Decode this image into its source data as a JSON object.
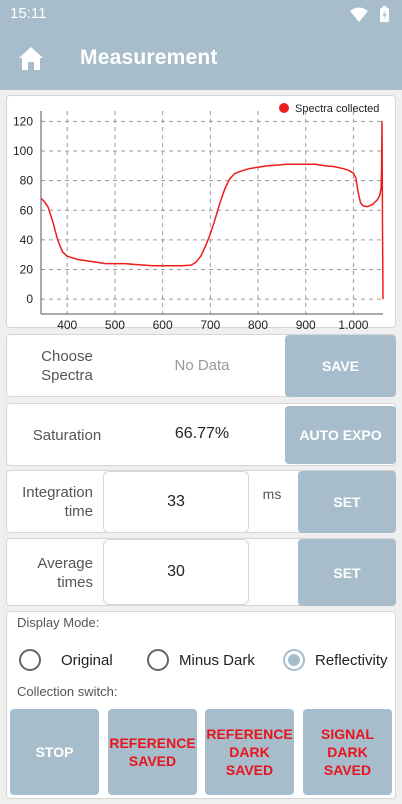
{
  "status_bar": {
    "time": "15:11",
    "icons": [
      "wifi-icon",
      "battery-charging-icon"
    ]
  },
  "app_bar": {
    "title": "Measurement",
    "home_icon": "home-icon"
  },
  "chart_data": {
    "type": "line",
    "title": "",
    "xlabel": "",
    "ylabel": "",
    "legend": {
      "label": "Spectra collected",
      "position": "top-right",
      "color": "#ee1c1c"
    },
    "xlim": [
      345,
      1062
    ],
    "ylim": [
      -10,
      127
    ],
    "x_ticks": [
      "400",
      "500",
      "600",
      "700",
      "800",
      "900",
      "1,000"
    ],
    "y_ticks": [
      "0",
      "20",
      "40",
      "60",
      "80",
      "100",
      "120"
    ],
    "grid": true,
    "series": [
      {
        "name": "Spectra collected",
        "color": "#ee1c1c",
        "x": [
          345,
          352,
          360,
          370,
          380,
          390,
          400,
          420,
          440,
          460,
          480,
          500,
          520,
          540,
          560,
          580,
          600,
          620,
          640,
          660,
          670,
          680,
          690,
          700,
          710,
          720,
          730,
          740,
          750,
          760,
          770,
          780,
          790,
          800,
          820,
          840,
          860,
          880,
          900,
          920,
          940,
          960,
          980,
          990,
          1000,
          1005,
          1010,
          1015,
          1020,
          1030,
          1040,
          1050,
          1055,
          1058,
          1059,
          1060,
          1061,
          1062
        ],
        "y": [
          68,
          66,
          62,
          52,
          40,
          32,
          29,
          27,
          26,
          25,
          24,
          24,
          24,
          23.5,
          23,
          22.5,
          22.5,
          22.5,
          22.5,
          23,
          25,
          29,
          36,
          44,
          54,
          65,
          74,
          81,
          84.5,
          86,
          87,
          88,
          88.5,
          89,
          90,
          90.5,
          91,
          91,
          91,
          91,
          90,
          89.5,
          88,
          87,
          85,
          82,
          72,
          65,
          63,
          62.5,
          64,
          67,
          70,
          75,
          90,
          120,
          50,
          0
        ]
      }
    ]
  },
  "choose_spectra": {
    "label": "Choose Spectra",
    "value": "No Data",
    "button": "SAVE"
  },
  "saturation": {
    "label": "Saturation",
    "value": "66.77%",
    "button": "AUTO EXPO"
  },
  "integration": {
    "label": "Integration time",
    "value": "33",
    "unit": "ms",
    "button": "SET"
  },
  "average": {
    "label": "Average times",
    "value": "30",
    "button": "SET"
  },
  "display_mode": {
    "label": "Display Mode:",
    "options": [
      "Original",
      "Minus Dark",
      "Reflectivity"
    ],
    "selected": "Reflectivity"
  },
  "collection": {
    "label": "Collection switch:",
    "buttons": [
      "STOP",
      "REFERENCE SAVED",
      "REFERENCE DARK SAVED",
      "SIGNAL DARK SAVED"
    ]
  },
  "colors": {
    "accent": "#a7bdcc",
    "series": "#ee1c1c",
    "saved_text": "#e8141c"
  }
}
